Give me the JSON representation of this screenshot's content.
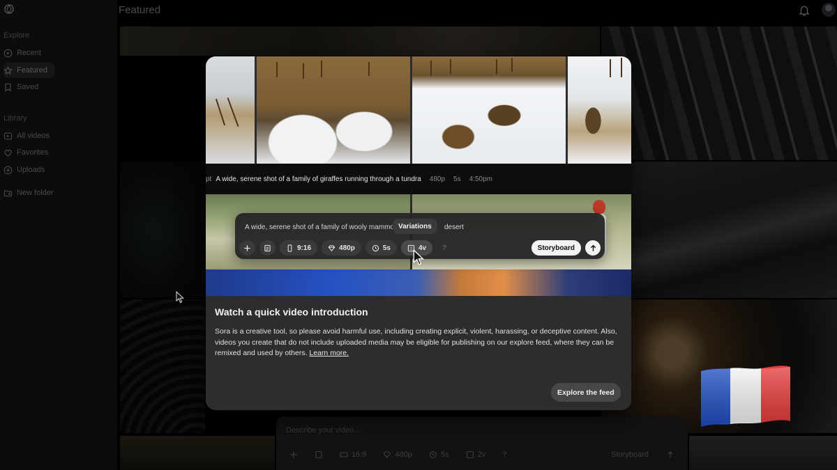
{
  "header": {
    "title": "Featured"
  },
  "sidebar": {
    "explore_label": "Explore",
    "library_label": "Library",
    "items": [
      {
        "label": "Recent"
      },
      {
        "label": "Featured"
      },
      {
        "label": "Saved"
      },
      {
        "label": "All videos"
      },
      {
        "label": "Favorites"
      },
      {
        "label": "Uploads"
      },
      {
        "label": "New folder"
      }
    ]
  },
  "modal": {
    "caption": {
      "prefix": "pt",
      "text": "A wide, serene shot of a family of giraffes running through a tundra",
      "resolution": "480p",
      "duration": "5s",
      "time": "4:50pm"
    },
    "composer": {
      "prompt_start": "A wide, serene shot of a family of wooly mammo",
      "prompt_end": "desert",
      "tooltip": "Variations",
      "aspect": "9:16",
      "resolution": "480p",
      "duration": "5s",
      "variations": "4v",
      "help": "?",
      "storyboard": "Storyboard"
    },
    "title": "Watch a quick video introduction",
    "body": "Sora is a creative tool, so please avoid harmful use, including creating explicit, violent, harassing, or deceptive content. Also, videos you create that do not include uploaded media may be eligible for publishing on our explore feed, where they can be remixed and used by others.",
    "learn_more": "Learn more.",
    "explore_button": "Explore the feed"
  },
  "bg_composer": {
    "placeholder": "Describe your video...",
    "aspect": "16:9",
    "resolution": "480p",
    "duration": "5s",
    "variations": "2v",
    "help": "?",
    "storyboard": "Storyboard"
  },
  "colors": {
    "flag_blue": "#1f4fc4",
    "flag_white": "#f4f4f4",
    "flag_red": "#e63a3a"
  }
}
